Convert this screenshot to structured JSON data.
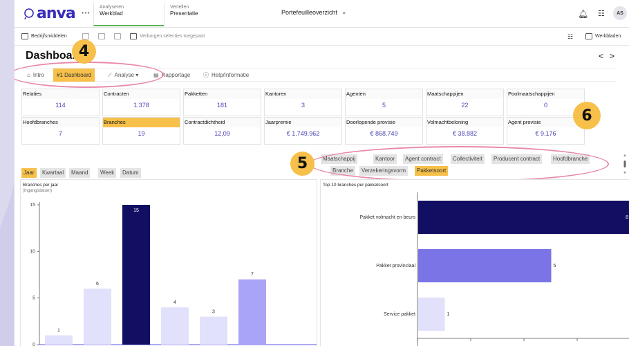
{
  "app": {
    "logo_text": "anva",
    "menu_dots": "···",
    "nav_tabs": [
      {
        "small": "Analyseren",
        "big": "Werkblad",
        "active": true
      },
      {
        "small": "Vertellen",
        "big": "Presentatie",
        "active": false
      }
    ],
    "center_title": "Portefeuilleoverzicht",
    "avatar_initials": "AS"
  },
  "toolbar2": {
    "bedrijfsmiddelen": "Bedrijfsmiddelen",
    "hidden_selections": "Verborgen selecties toegepast",
    "werkbladen": "Werkbladen"
  },
  "dashboard": {
    "title": "Dashboard",
    "prev": "<",
    "next": ">"
  },
  "callouts": {
    "four": "4",
    "five": "5",
    "six": "6"
  },
  "menu_tabs": [
    {
      "label": "Intro",
      "icon": "home-icon",
      "glyph": "⌂",
      "active": false
    },
    {
      "label": "#1 Dashboard",
      "icon": "",
      "glyph": "",
      "active": true
    },
    {
      "label": "Analyse ▾",
      "icon": "line-chart-icon",
      "glyph": "⟋",
      "active": false
    },
    {
      "label": "Rapportage",
      "icon": "report-icon",
      "glyph": "▤",
      "active": false
    },
    {
      "label": "Help/Informatie",
      "icon": "info-icon",
      "glyph": "ⓘ",
      "active": false
    }
  ],
  "kpis_row1": [
    {
      "label": "Relaties",
      "value": "114"
    },
    {
      "label": "Contracten",
      "value": "1.378"
    },
    {
      "label": "Pakketten",
      "value": "181"
    },
    {
      "label": "Kantoren",
      "value": "3"
    },
    {
      "label": "Agenten",
      "value": "5"
    },
    {
      "label": "Maatschappijen",
      "value": "22"
    },
    {
      "label": "Poolmaatschappijen",
      "value": "0"
    }
  ],
  "kpis_row2": [
    {
      "label": "Hoofdbranches",
      "value": "7",
      "active": false
    },
    {
      "label": "Branches",
      "value": "19",
      "active": true
    },
    {
      "label": "Contractdichtheid",
      "value": "12,09",
      "active": false
    },
    {
      "label": "Jaarpremie",
      "value": "€ 1.749.962",
      "active": false
    },
    {
      "label": "Doorlopende provisie",
      "value": "€ 868.749",
      "active": false
    },
    {
      "label": "Volmachtbeloning",
      "value": "€ 38.882",
      "active": false
    },
    {
      "label": "Agent provisie",
      "value": "€ 9.176",
      "active": false
    }
  ],
  "filter_chips_row1": [
    {
      "label": "Maatschappij",
      "active": false
    },
    {
      "label": "Kantoor",
      "active": false
    },
    {
      "label": "Agent contract",
      "active": false
    },
    {
      "label": "Collectiviteit",
      "active": false
    },
    {
      "label": "Producent contract",
      "active": false
    },
    {
      "label": "Hoofdbranche",
      "active": false
    }
  ],
  "filter_chips_row2": [
    {
      "label": "Branche",
      "active": false
    },
    {
      "label": "Verzekeringsvorm",
      "active": false
    },
    {
      "label": "Pakketsoort",
      "active": true
    }
  ],
  "time_tabs": [
    {
      "label": "Jaar",
      "active": true
    },
    {
      "label": "Kwartaal",
      "active": false
    },
    {
      "label": "Maand",
      "active": false
    },
    {
      "label": "Week",
      "active": false
    },
    {
      "label": "Datum",
      "active": false
    }
  ],
  "colors": {
    "accent": "#f6c04a",
    "brand": "#3a2dbb",
    "kpi_value": "#4a44b5",
    "highlight_ellipse": "#e889a8",
    "bar_dark": "#120e62",
    "bar_mid": "#7b74e7",
    "bar_light": "#a9a4f6",
    "bar_pale": "#e2e1fb"
  },
  "chart_data": [
    {
      "type": "bar",
      "title": "Branches per jaar",
      "subtitle": "(Ingangsdatum)",
      "xlabel": "",
      "ylabel": "",
      "ylim": [
        0,
        15
      ],
      "yticks": [
        0,
        5,
        10,
        15
      ],
      "grid": false,
      "categories": [
        "",
        "",
        "",
        "",
        "",
        ""
      ],
      "values": [
        1,
        6,
        15,
        4,
        3,
        7
      ],
      "bar_colors": [
        "#e2e1fb",
        "#e2e1fb",
        "#120e62",
        "#e2e1fb",
        "#e2e1fb",
        "#a9a4f6"
      ]
    },
    {
      "type": "bar",
      "orientation": "horizontal",
      "title": "Top 10 branches per pakketsoort",
      "xlabel": "",
      "ylabel": "",
      "xlim": [
        0,
        8
      ],
      "grid": false,
      "categories": [
        "Pakket volmacht en beurs",
        "Pakket provinciaal",
        "Service pakket"
      ],
      "values": [
        8,
        5,
        1
      ],
      "bar_colors": [
        "#120e62",
        "#7b74e7",
        "#e2e1fb"
      ]
    }
  ]
}
